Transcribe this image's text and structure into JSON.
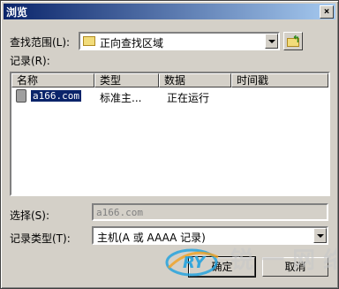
{
  "window": {
    "title": "浏览",
    "close_label": "×"
  },
  "search_scope": {
    "label": "查找范围(L):",
    "value": "正向查找区域"
  },
  "records": {
    "label": "记录(R):",
    "columns": [
      "名称",
      "类型",
      "数据",
      "时间戳"
    ],
    "rows": [
      {
        "name": "a166.com",
        "type": "标准主...",
        "data": "正在运行",
        "timestamp": ""
      }
    ]
  },
  "selection": {
    "label": "选择(S):",
    "value": "a166.com"
  },
  "record_type": {
    "label": "记录类型(T):",
    "value": "主机(A 或 AAAA 记录)"
  },
  "buttons": {
    "ok": "确定",
    "cancel": "取消"
  },
  "watermark": {
    "text": "RY",
    "chars": "锐 一 网 络"
  },
  "colors": {
    "titlebar_start": "#0a246a",
    "titlebar_end": "#a6caf0",
    "selection": "#0a246a",
    "face": "#d4d0c8"
  }
}
